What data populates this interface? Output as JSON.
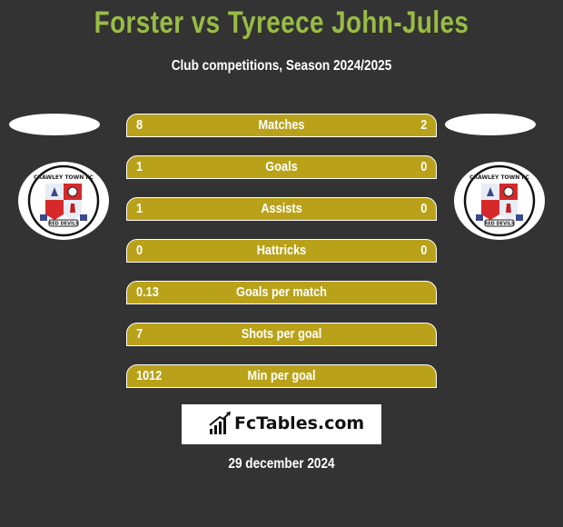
{
  "header": {
    "title": "Forster vs Tyreece John-Jules",
    "subtitle": "Club competitions, Season 2024/2025"
  },
  "players": {
    "left": {
      "name": "Forster",
      "club_logo": "crawley-town-fc-badge"
    },
    "right": {
      "name": "Tyreece John-Jules",
      "club_logo": "crawley-town-fc-badge"
    }
  },
  "stats": [
    {
      "label": "Matches",
      "left": "8",
      "right": "2"
    },
    {
      "label": "Goals",
      "left": "1",
      "right": "0"
    },
    {
      "label": "Assists",
      "left": "1",
      "right": "0"
    },
    {
      "label": "Hattricks",
      "left": "0",
      "right": "0"
    },
    {
      "label": "Goals per match",
      "left": "0.13",
      "right": ""
    },
    {
      "label": "Shots per goal",
      "left": "7",
      "right": ""
    },
    {
      "label": "Min per goal",
      "left": "1012",
      "right": ""
    }
  ],
  "brand": {
    "name": "FcTables.com",
    "icon": "bar-chart-icon"
  },
  "date": "29 december 2024",
  "colors": {
    "background": "#333333",
    "title": "#99bb44",
    "bar": "#b9a21a",
    "text": "#ffffff"
  }
}
